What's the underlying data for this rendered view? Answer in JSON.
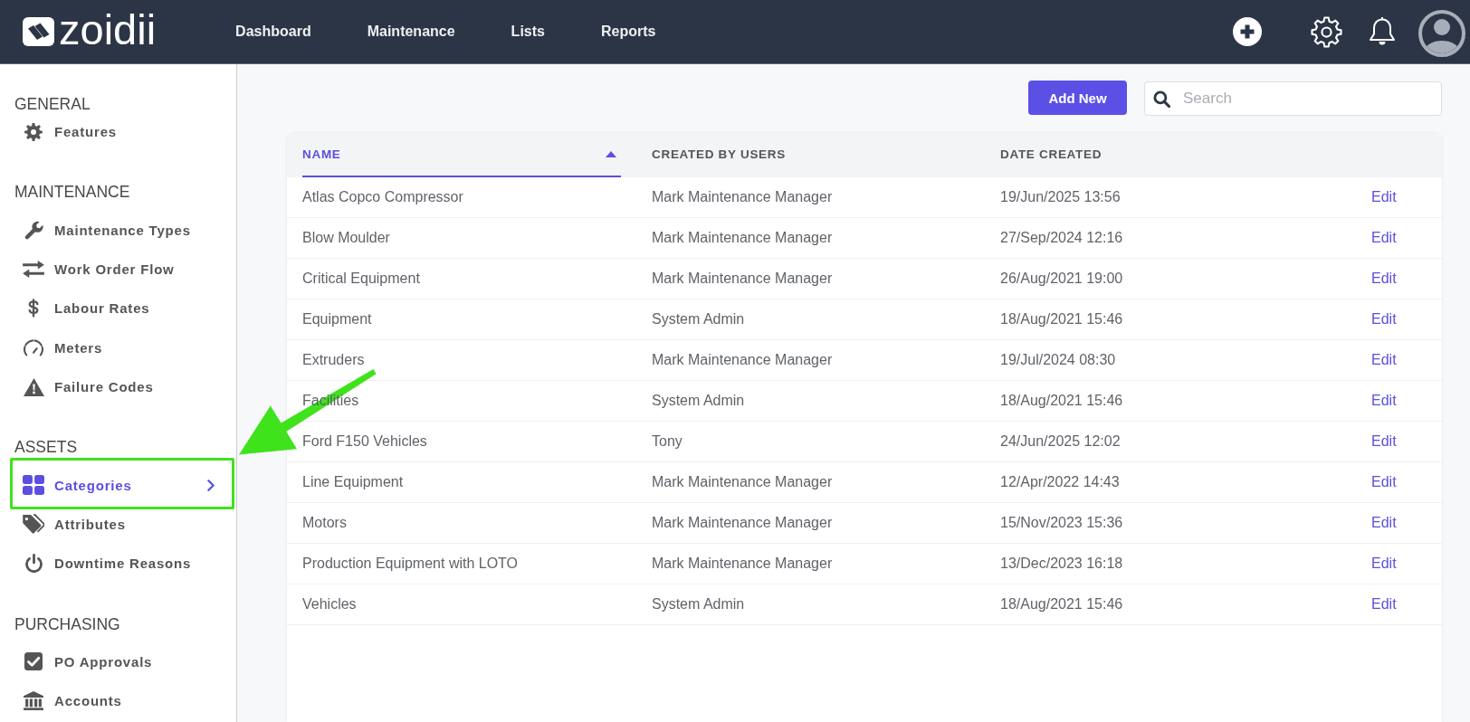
{
  "header": {
    "brand": "zoidii",
    "nav": [
      {
        "label": "Dashboard"
      },
      {
        "label": "Maintenance"
      },
      {
        "label": "Lists"
      },
      {
        "label": "Reports"
      }
    ]
  },
  "sidebar": {
    "sections": [
      {
        "title": "GENERAL",
        "items": [
          {
            "label": "Features",
            "selected": false,
            "highlighted": false
          }
        ]
      },
      {
        "title": "MAINTENANCE",
        "items": [
          {
            "label": "Maintenance Types",
            "selected": false,
            "highlighted": false
          },
          {
            "label": "Work Order Flow",
            "selected": false,
            "highlighted": false
          },
          {
            "label": "Labour Rates",
            "selected": false,
            "highlighted": false
          },
          {
            "label": "Meters",
            "selected": false,
            "highlighted": false
          },
          {
            "label": "Failure Codes",
            "selected": false,
            "highlighted": false
          }
        ]
      },
      {
        "title": "ASSETS",
        "items": [
          {
            "label": "Categories",
            "selected": true,
            "highlighted": true
          },
          {
            "label": "Attributes",
            "selected": false,
            "highlighted": false
          },
          {
            "label": "Downtime Reasons",
            "selected": false,
            "highlighted": false
          }
        ]
      },
      {
        "title": "PURCHASING",
        "items": [
          {
            "label": "PO Approvals",
            "selected": false,
            "highlighted": false
          },
          {
            "label": "Accounts",
            "selected": false,
            "highlighted": false
          }
        ]
      }
    ]
  },
  "toolbar": {
    "add_button": "Add New",
    "search": {
      "placeholder": "Search"
    }
  },
  "table": {
    "columns": [
      {
        "label": "NAME",
        "sorted": true
      },
      {
        "label": "CREATED BY USERS",
        "sorted": false
      },
      {
        "label": "DATE CREATED",
        "sorted": false
      }
    ],
    "rows": [
      {
        "name": "Atlas Copco Compressor",
        "created_by": "Mark Maintenance Manager",
        "date_created": "19/Jun/2025 13:56",
        "action": "Edit"
      },
      {
        "name": "Blow Moulder",
        "created_by": "Mark Maintenance Manager",
        "date_created": "27/Sep/2024 12:16",
        "action": "Edit"
      },
      {
        "name": "Critical Equipment",
        "created_by": "Mark Maintenance Manager",
        "date_created": "26/Aug/2021 19:00",
        "action": "Edit"
      },
      {
        "name": "Equipment",
        "created_by": "System Admin",
        "date_created": "18/Aug/2021 15:46",
        "action": "Edit"
      },
      {
        "name": "Extruders",
        "created_by": "Mark Maintenance Manager",
        "date_created": "19/Jul/2024 08:30",
        "action": "Edit"
      },
      {
        "name": "Facilities",
        "created_by": "System Admin",
        "date_created": "18/Aug/2021 15:46",
        "action": "Edit"
      },
      {
        "name": "Ford F150 Vehicles",
        "created_by": "Tony",
        "date_created": "24/Jun/2025 12:02",
        "action": "Edit"
      },
      {
        "name": "Line Equipment",
        "created_by": "Mark Maintenance Manager",
        "date_created": "12/Apr/2022 14:43",
        "action": "Edit"
      },
      {
        "name": "Motors",
        "created_by": "Mark Maintenance Manager",
        "date_created": "15/Nov/2023 15:36",
        "action": "Edit"
      },
      {
        "name": "Production Equipment with LOTO",
        "created_by": "Mark Maintenance Manager",
        "date_created": "13/Dec/2023 16:18",
        "action": "Edit"
      },
      {
        "name": "Vehicles",
        "created_by": "System Admin",
        "date_created": "18/Aug/2021 15:46",
        "action": "Edit"
      }
    ]
  }
}
